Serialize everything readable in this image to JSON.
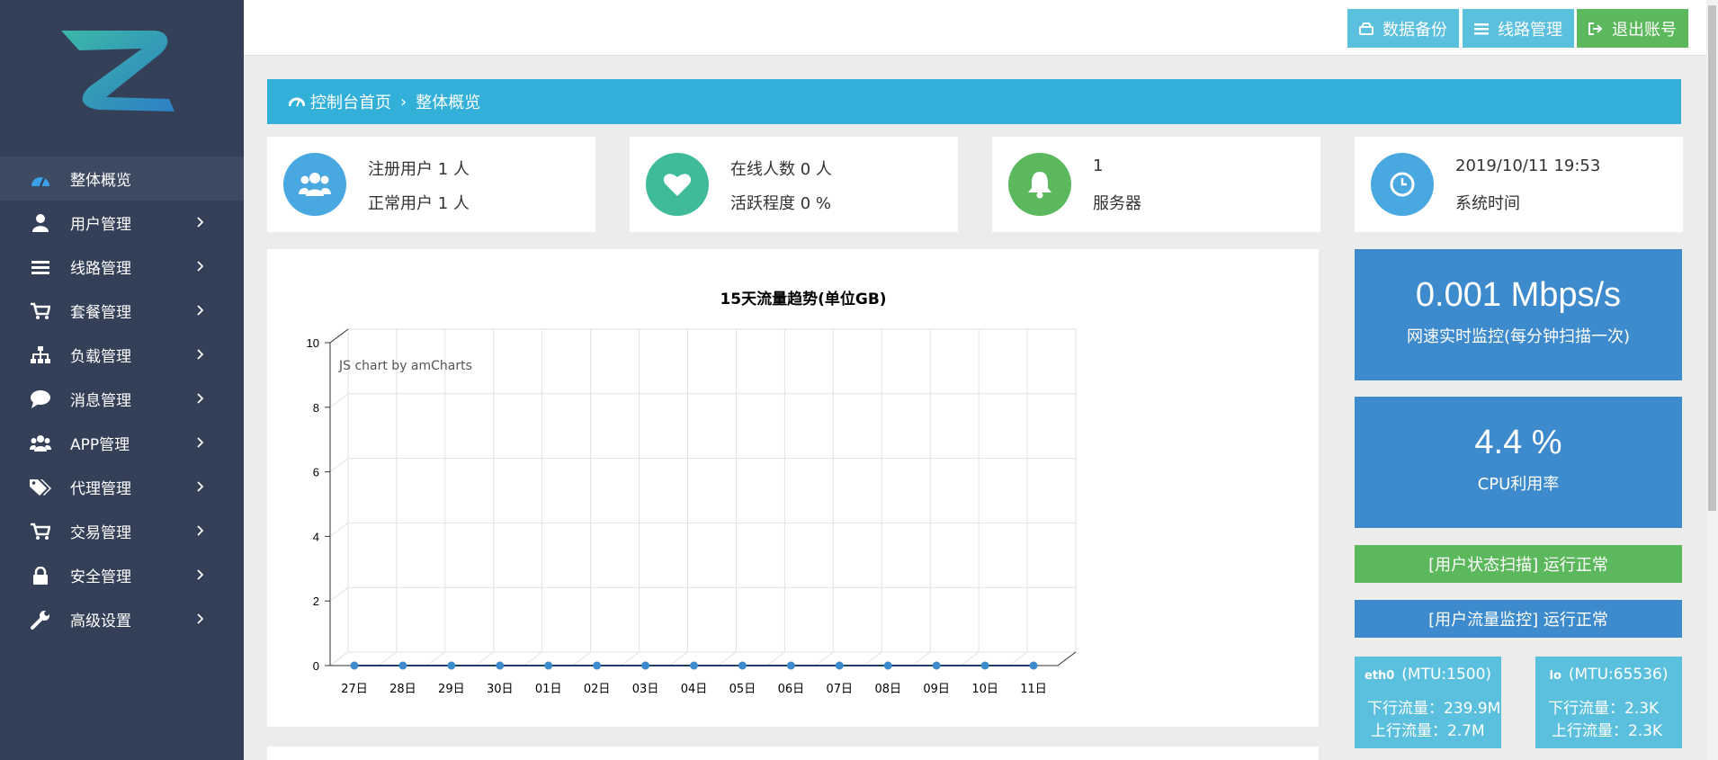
{
  "topbar": {
    "backup_label": "数据备份",
    "lines_label": "线路管理",
    "logout_label": "退出账号"
  },
  "sidebar": {
    "items": [
      {
        "label": "整体概览",
        "icon": "dashboard-icon",
        "active": true
      },
      {
        "label": "用户管理",
        "icon": "user-icon"
      },
      {
        "label": "线路管理",
        "icon": "list-icon"
      },
      {
        "label": "套餐管理",
        "icon": "cart-icon"
      },
      {
        "label": "负载管理",
        "icon": "sitemap-icon"
      },
      {
        "label": "消息管理",
        "icon": "comment-icon"
      },
      {
        "label": "APP管理",
        "icon": "users-icon"
      },
      {
        "label": "代理管理",
        "icon": "tags-icon"
      },
      {
        "label": "交易管理",
        "icon": "cart-icon"
      },
      {
        "label": "安全管理",
        "icon": "lock-icon"
      },
      {
        "label": "高级设置",
        "icon": "wrench-icon"
      }
    ]
  },
  "breadcrumb": {
    "home": "控制台首页",
    "sep": "›",
    "current": "整体概览"
  },
  "cards": [
    {
      "line1": "注册用户 1 人",
      "line2": "正常用户 1 人",
      "color": "#49a8e0",
      "icon": "users-icon"
    },
    {
      "line1": "在线人数 0 人",
      "line2": "活跃程度 0 %",
      "color": "#3fbb9a",
      "icon": "heart-icon"
    },
    {
      "line1": "1",
      "line2": "服务器",
      "color": "#5cb85c",
      "icon": "bell-icon"
    },
    {
      "line1": "2019/10/11 19:53",
      "line2": "系统时间",
      "color": "#49a8e0",
      "icon": "clock-icon"
    }
  ],
  "network": {
    "value": "0.001 Mbps/s",
    "label": "网速实时监控(每分钟扫描一次)"
  },
  "cpu": {
    "value": "4.4 %",
    "label": "CPU利用率"
  },
  "status": {
    "user_scan": "[用户状态扫描] 运行正常",
    "traffic_monitor": "[用户流量监控] 运行正常"
  },
  "interfaces": [
    {
      "name": "eth0",
      "mtu": "(MTU:1500)",
      "down": "下行流量：239.9M",
      "up": "上行流量：2.7M"
    },
    {
      "name": "lo",
      "mtu": "(MTU:65536)",
      "down": "下行流量：2.3K",
      "up": "上行流量：2.3K"
    }
  ],
  "chart_data": {
    "type": "line",
    "title": "15天流量趋势(单位GB)",
    "watermark": "JS chart by amCharts",
    "categories": [
      "27日",
      "28日",
      "29日",
      "30日",
      "01日",
      "02日",
      "03日",
      "04日",
      "05日",
      "06日",
      "07日",
      "08日",
      "09日",
      "10日",
      "11日"
    ],
    "series": [
      {
        "values": [
          0,
          0,
          0,
          0,
          0,
          0,
          0,
          0,
          0,
          0,
          0,
          0,
          0,
          0,
          0
        ]
      }
    ],
    "ylim": [
      0,
      10
    ],
    "yticks": [
      0,
      2,
      4,
      6,
      8,
      10
    ],
    "grid": true,
    "color": "#3d8bcd"
  }
}
